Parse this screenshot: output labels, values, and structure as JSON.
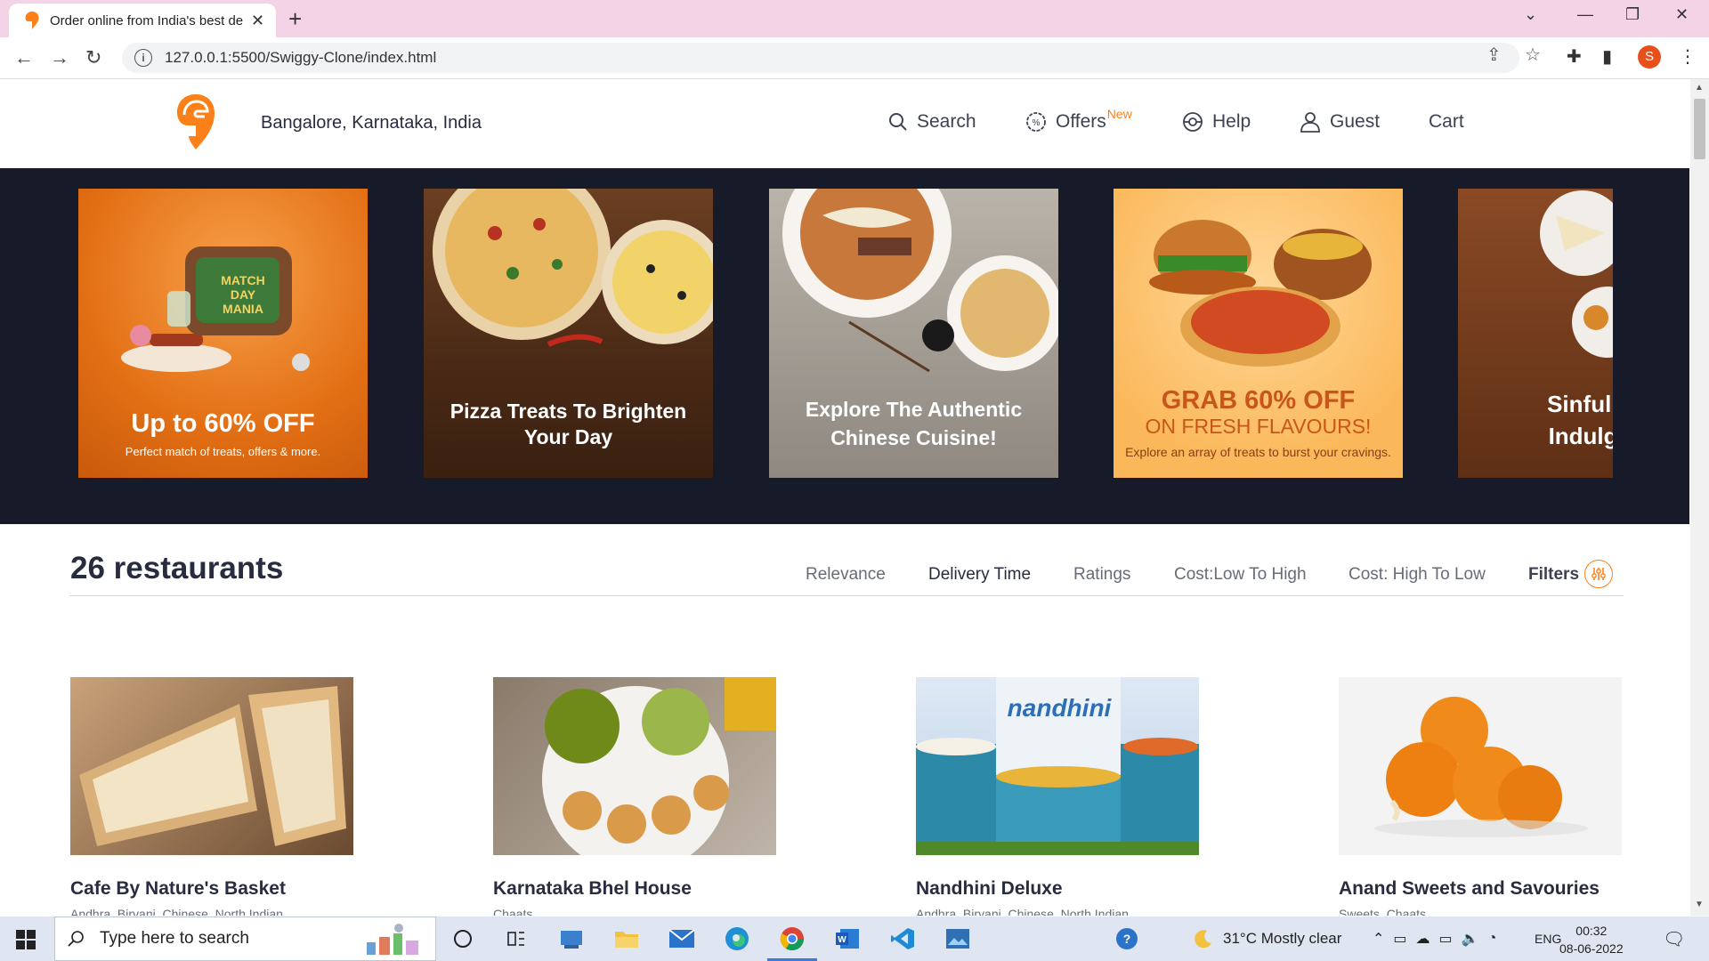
{
  "browser": {
    "tab_title": "Order online from India's best delivery app",
    "url": "127.0.0.1:5500/Swiggy-Clone/index.html",
    "profile_initial": "S"
  },
  "header": {
    "location": "Bangalore, Karnataka, India",
    "nav": {
      "search": "Search",
      "offers": "Offers",
      "offers_tag": "New",
      "help": "Help",
      "guest": "Guest",
      "cart": "Cart"
    }
  },
  "banners": [
    {
      "title": "Up to 60% OFF",
      "subtitle": "Perfect match of treats, offers & more.",
      "badge": "MATCH DAY MANIA"
    },
    {
      "title": "Pizza Treats To Brighten Your Day"
    },
    {
      "title": "Explore The Authentic Chinese Cuisine!"
    },
    {
      "title": "GRAB 60% OFF",
      "subtitle": "ON FRESH FLAVOURS!",
      "caption": "Explore an array of treats to burst your cravings."
    },
    {
      "title": "Sinfully Indulge"
    }
  ],
  "listing": {
    "count_label": "26 restaurants",
    "sort_options": [
      "Relevance",
      "Delivery Time",
      "Ratings",
      "Cost:Low To High",
      "Cost: High To Low"
    ],
    "active_sort": "Delivery Time",
    "filters_label": "Filters"
  },
  "restaurants": [
    {
      "name": "Cafe By Nature's Basket",
      "cuisine": "Andhra, Biryani, Chinese, North Indian"
    },
    {
      "name": "Karnataka Bhel House",
      "cuisine": "Chaats"
    },
    {
      "name": "Nandhini Deluxe",
      "cuisine": "Andhra, Biryani, Chinese, North Indian",
      "brand": "nandhini"
    },
    {
      "name": "Anand Sweets and Savouries",
      "cuisine": "Sweets, Chaats"
    }
  ],
  "taskbar": {
    "search_placeholder": "Type here to search",
    "weather": "31°C  Mostly clear",
    "language": "ENG",
    "time": "00:32",
    "date": "08-06-2022"
  },
  "colors": {
    "brand": "#fc8019",
    "banner_bg": "#171a29",
    "tab_strip": "#f5d3e6"
  }
}
